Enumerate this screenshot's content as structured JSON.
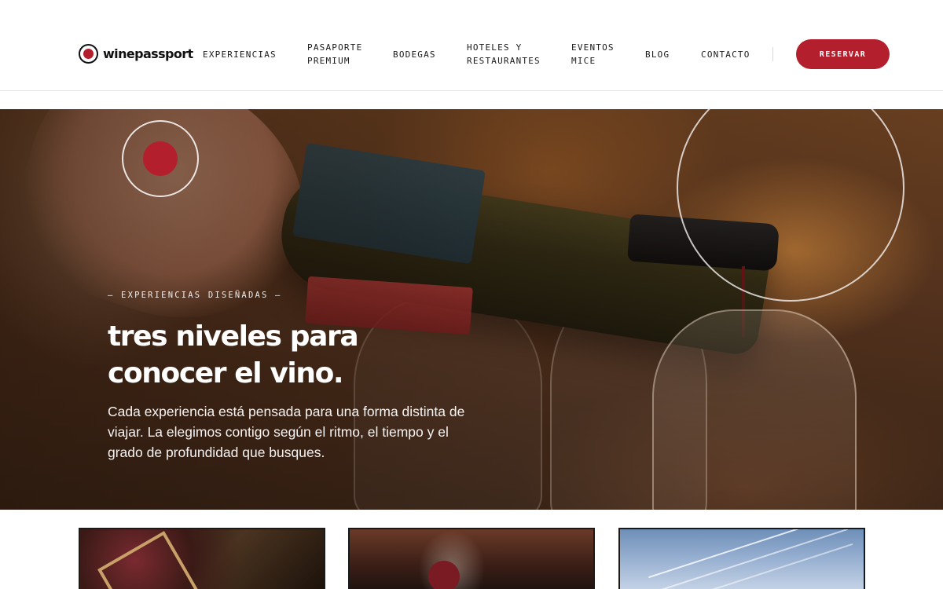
{
  "brand": {
    "name": "winepassport",
    "accent_color": "#b31f2c"
  },
  "nav": {
    "items": [
      {
        "label_line1": "EXPERIENCIAS",
        "label_line2": ""
      },
      {
        "label_line1": "PASAPORTE",
        "label_line2": "PREMIUM"
      },
      {
        "label_line1": "BODEGAS",
        "label_line2": ""
      },
      {
        "label_line1": "HOTELES Y",
        "label_line2": "RESTAURANTES"
      },
      {
        "label_line1": "EVENTOS",
        "label_line2": "MICE"
      },
      {
        "label_line1": "BLOG",
        "label_line2": ""
      },
      {
        "label_line1": "CONTACTO",
        "label_line2": ""
      }
    ],
    "cta_label": "RESERVAR"
  },
  "hero": {
    "eyebrow": "— EXPERIENCIAS DISEÑADAS —",
    "title_line1": "tres niveles para",
    "title_line2": "conocer el vino.",
    "description": "Cada experiencia está pensada para una forma distinta de viajar. La elegimos contigo según el ritmo, el tiempo y el grado de profundidad que busques."
  },
  "icons": {
    "logo": "record-circle-icon",
    "hero_marker": "target-dot-icon"
  }
}
